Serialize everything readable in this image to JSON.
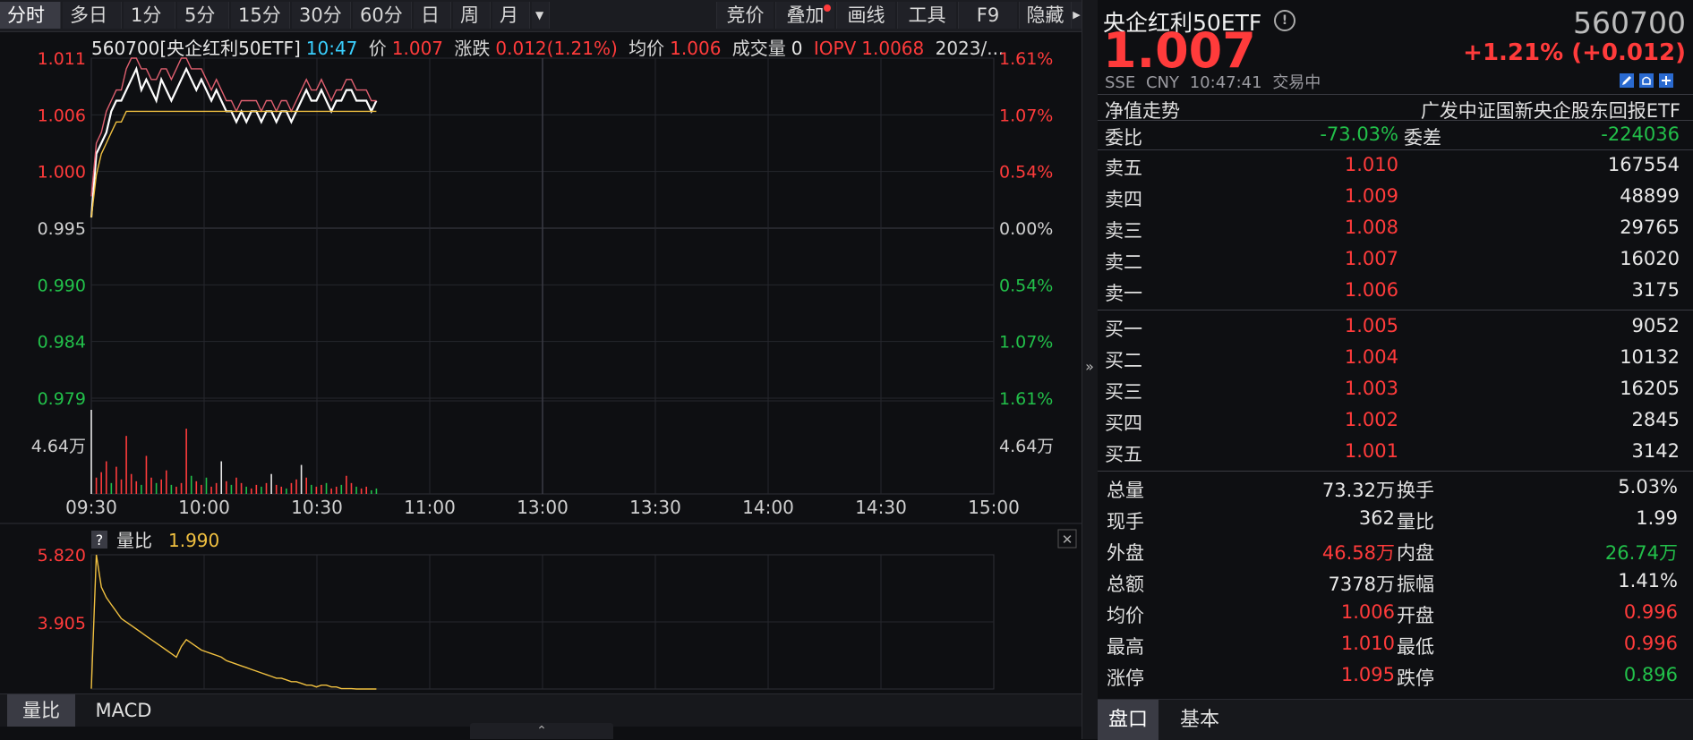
{
  "toolbar": {
    "tabs": [
      "分时",
      "多日",
      "1分",
      "5分",
      "15分",
      "30分",
      "60分",
      "日",
      "周",
      "月"
    ],
    "active_tab": "分时",
    "dropdown_glyph": "▼",
    "tools": [
      "竞价",
      "叠加",
      "画线",
      "工具",
      "F9",
      "隐藏"
    ],
    "more_glyph": "▶"
  },
  "info_line": {
    "code_name": "560700[央企红利50ETF]",
    "time": "10:47",
    "price_label": "价",
    "price": "1.007",
    "change_label": "涨跌",
    "change": "0.012(1.21%)",
    "avg_label": "均价",
    "avg": "1.006",
    "volume_label": "成交量",
    "volume": "0",
    "iopv_label": "IOPV",
    "iopv": "1.0068",
    "date": "2023/..."
  },
  "chart_data": [
    {
      "type": "line",
      "name": "intraday",
      "x_ticks": [
        "09:30",
        "10:00",
        "10:30",
        "11:00",
        "13:00",
        "13:30",
        "14:00",
        "14:30",
        "15:00"
      ],
      "y_left": [
        "1.011",
        "1.006",
        "1.000",
        "0.995",
        "0.990",
        "0.984",
        "0.979"
      ],
      "y_right": [
        "1.61%",
        "1.07%",
        "0.54%",
        "0.00%",
        "0.54%",
        "1.07%",
        "1.61%"
      ],
      "ylim": [
        0.979,
        1.011
      ],
      "reference_price": 0.995,
      "volume_axis_label": "4.64万",
      "series": [
        {
          "name": "价",
          "color": "#ffffff",
          "values": [
            0.996,
            1.002,
            1.003,
            1.004,
            1.006,
            1.007,
            1.007,
            1.008,
            1.009,
            1.01,
            1.008,
            1.009,
            1.008,
            1.007,
            1.009,
            1.008,
            1.007,
            1.008,
            1.009,
            1.01,
            1.009,
            1.008,
            1.009,
            1.008,
            1.007,
            1.008,
            1.007,
            1.006,
            1.006,
            1.005,
            1.006,
            1.005,
            1.006,
            1.006,
            1.005,
            1.006,
            1.006,
            1.005,
            1.006,
            1.006,
            1.005,
            1.006,
            1.007,
            1.008,
            1.007,
            1.007,
            1.008,
            1.007,
            1.006,
            1.007,
            1.007,
            1.008,
            1.008,
            1.007,
            1.007,
            1.007,
            1.006,
            1.007
          ]
        },
        {
          "name": "IOPV",
          "color": "#e06070",
          "values": [
            0.998,
            1.003,
            1.004,
            1.006,
            1.007,
            1.008,
            1.008,
            1.01,
            1.011,
            1.011,
            1.01,
            1.01,
            1.009,
            1.009,
            1.01,
            1.01,
            1.009,
            1.01,
            1.011,
            1.011,
            1.01,
            1.01,
            1.01,
            1.009,
            1.008,
            1.009,
            1.008,
            1.007,
            1.007,
            1.006,
            1.007,
            1.007,
            1.007,
            1.007,
            1.006,
            1.007,
            1.007,
            1.006,
            1.007,
            1.007,
            1.006,
            1.007,
            1.008,
            1.009,
            1.008,
            1.008,
            1.009,
            1.008,
            1.007,
            1.008,
            1.008,
            1.009,
            1.009,
            1.008,
            1.008,
            1.008,
            1.007,
            1.007
          ]
        },
        {
          "name": "均价",
          "color": "#f0c040",
          "values": [
            0.996,
            1.0,
            1.002,
            1.003,
            1.004,
            1.005,
            1.005,
            1.006,
            1.006,
            1.006,
            1.006,
            1.006,
            1.006,
            1.006,
            1.006,
            1.006,
            1.006,
            1.006,
            1.006,
            1.006,
            1.006,
            1.006,
            1.006,
            1.006,
            1.006,
            1.006,
            1.006,
            1.006,
            1.006,
            1.006,
            1.006,
            1.006,
            1.006,
            1.006,
            1.006,
            1.006,
            1.006,
            1.006,
            1.006,
            1.006,
            1.006,
            1.006,
            1.006,
            1.006,
            1.006,
            1.006,
            1.006,
            1.006,
            1.006,
            1.006,
            1.006,
            1.006,
            1.006,
            1.006,
            1.006,
            1.006,
            1.006,
            1.006
          ]
        }
      ],
      "volumes": [
        4.64,
        0.9,
        1.2,
        1.8,
        0.6,
        1.5,
        0.8,
        3.2,
        1.1,
        0.7,
        0.5,
        2.1,
        0.9,
        0.6,
        0.8,
        1.3,
        0.5,
        0.4,
        0.6,
        3.6,
        1.0,
        0.7,
        0.5,
        0.9,
        0.4,
        0.6,
        1.8,
        0.7,
        0.5,
        0.9,
        0.6,
        0.4,
        0.3,
        0.5,
        0.4,
        0.6,
        1.1,
        0.5,
        0.4,
        0.3,
        0.6,
        0.8,
        1.6,
        0.9,
        0.5,
        0.4,
        0.5,
        0.6,
        0.3,
        0.4,
        0.5,
        1.0,
        0.6,
        0.4,
        0.3,
        0.4,
        0.2,
        0.3
      ],
      "volume_colors": [
        "w",
        "r",
        "r",
        "r",
        "g",
        "r",
        "r",
        "r",
        "r",
        "r",
        "g",
        "r",
        "r",
        "g",
        "r",
        "r",
        "g",
        "r",
        "r",
        "r",
        "g",
        "r",
        "r",
        "g",
        "r",
        "r",
        "w",
        "r",
        "g",
        "r",
        "r",
        "g",
        "r",
        "r",
        "g",
        "r",
        "w",
        "r",
        "r",
        "g",
        "r",
        "r",
        "w",
        "r",
        "g",
        "r",
        "r",
        "g",
        "r",
        "r",
        "g",
        "r",
        "r",
        "g",
        "r",
        "r",
        "g",
        "g"
      ]
    },
    {
      "type": "line",
      "name": "量比",
      "indicator_label": "量比",
      "indicator_value": "1.990",
      "help_glyph": "?",
      "y_ticks": [
        "5.820",
        "3.905"
      ],
      "series": [
        {
          "name": "量比",
          "color": "#f0c040",
          "values": [
            2.0,
            5.82,
            4.9,
            4.6,
            4.4,
            4.2,
            4.0,
            3.9,
            3.8,
            3.7,
            3.6,
            3.5,
            3.4,
            3.3,
            3.2,
            3.1,
            3.0,
            2.9,
            3.2,
            3.4,
            3.3,
            3.2,
            3.1,
            3.05,
            3.0,
            2.95,
            2.9,
            2.8,
            2.75,
            2.7,
            2.65,
            2.6,
            2.55,
            2.5,
            2.45,
            2.4,
            2.35,
            2.3,
            2.3,
            2.25,
            2.2,
            2.2,
            2.15,
            2.1,
            2.1,
            2.05,
            2.1,
            2.1,
            2.05,
            2.05,
            2.0,
            2.0,
            2.0,
            1.99,
            1.99,
            1.99,
            1.99,
            1.99
          ]
        }
      ]
    }
  ],
  "indicator_tabs": [
    "量比",
    "MACD"
  ],
  "active_indicator_tab": "量比",
  "collapse_glyph": "»",
  "expand_glyph": "⌃",
  "close_glyph": "✕",
  "quote": {
    "name": "央企红利50ETF",
    "info_glyph": "!",
    "code": "560700",
    "price": "1.007",
    "change": "+1.21% (+0.012)",
    "exchange": "SSE",
    "currency": "CNY",
    "time": "10:47:41",
    "status": "交易中",
    "nav_trend_label": "净值走势",
    "fund_name": "广发中证国新央企股东回报ETF",
    "weibi_label": "委比",
    "weibi": "-73.03%",
    "weicha_label": "委差",
    "weicha": "-224036"
  },
  "asks": [
    {
      "label": "卖五",
      "price": "1.010",
      "vol": "167554"
    },
    {
      "label": "卖四",
      "price": "1.009",
      "vol": "48899"
    },
    {
      "label": "卖三",
      "price": "1.008",
      "vol": "29765"
    },
    {
      "label": "卖二",
      "price": "1.007",
      "vol": "16020"
    },
    {
      "label": "卖一",
      "price": "1.006",
      "vol": "3175"
    }
  ],
  "bids": [
    {
      "label": "买一",
      "price": "1.005",
      "vol": "9052"
    },
    {
      "label": "买二",
      "price": "1.004",
      "vol": "10132"
    },
    {
      "label": "买三",
      "price": "1.003",
      "vol": "16205"
    },
    {
      "label": "买四",
      "price": "1.002",
      "vol": "2845"
    },
    {
      "label": "买五",
      "price": "1.001",
      "vol": "3142"
    }
  ],
  "stats": [
    {
      "l1": "总量",
      "v1": "73.32万",
      "c1": "white",
      "l2": "换手",
      "v2": "5.03%",
      "c2": "white"
    },
    {
      "l1": "现手",
      "v1": "362",
      "c1": "white",
      "l2": "量比",
      "v2": "1.99",
      "c2": "white"
    },
    {
      "l1": "外盘",
      "v1": "46.58万",
      "c1": "red",
      "l2": "内盘",
      "v2": "26.74万",
      "c2": "green"
    },
    {
      "l1": "总额",
      "v1": "7378万",
      "c1": "white",
      "l2": "振幅",
      "v2": "1.41%",
      "c2": "white"
    },
    {
      "l1": "均价",
      "v1": "1.006",
      "c1": "red",
      "l2": "开盘",
      "v2": "0.996",
      "c2": "red"
    },
    {
      "l1": "最高",
      "v1": "1.010",
      "c1": "red",
      "l2": "最低",
      "v2": "0.996",
      "c2": "red"
    },
    {
      "l1": "涨停",
      "v1": "1.095",
      "c1": "red",
      "l2": "跌停",
      "v2": "0.896",
      "c2": "green"
    }
  ],
  "bottom_tabs": [
    "盘口",
    "基本"
  ],
  "active_bottom_tab": "盘口"
}
